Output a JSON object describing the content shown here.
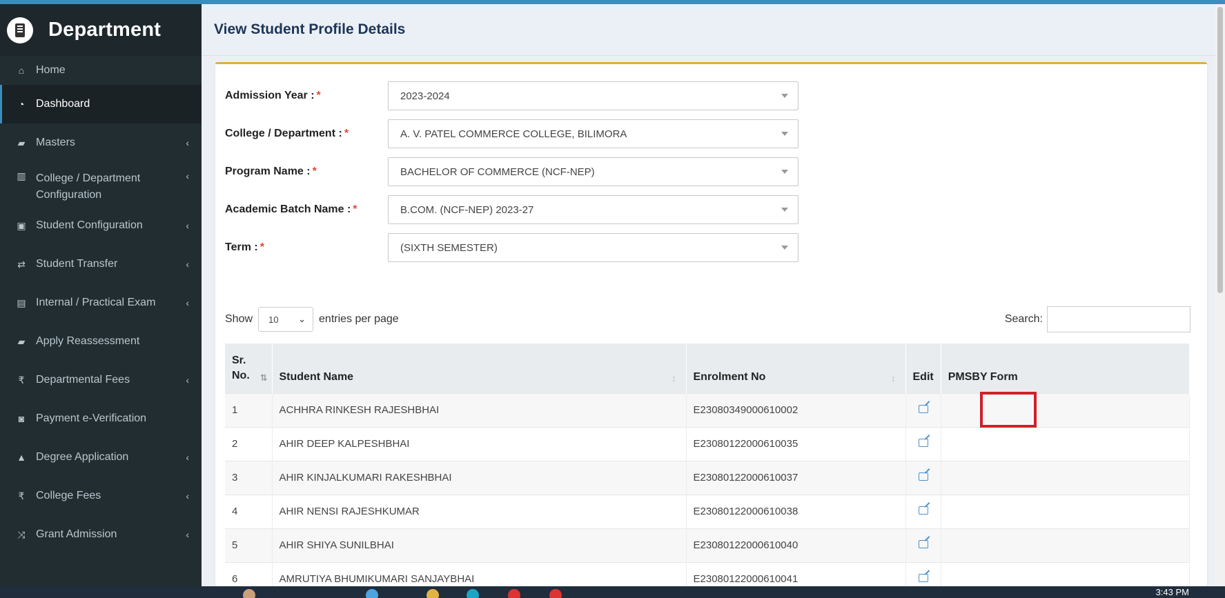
{
  "brand": {
    "title": "Department"
  },
  "sidebar": {
    "items": [
      {
        "label": "Home",
        "icon": "home-icon",
        "glyph": "⌂",
        "has_children": false
      },
      {
        "label": "Dashboard",
        "icon": "dashboard-icon",
        "glyph": "◔",
        "has_children": false,
        "active": true
      },
      {
        "label": "Masters",
        "icon": "book-icon",
        "glyph": "▰",
        "has_children": true
      },
      {
        "label": "College / Department Configuration",
        "icon": "institution-icon",
        "glyph": "▥",
        "has_children": true
      },
      {
        "label": "Student Configuration",
        "icon": "id-card-icon",
        "glyph": "▣",
        "has_children": true
      },
      {
        "label": "Student Transfer",
        "icon": "exchange-icon",
        "glyph": "⇄",
        "has_children": true
      },
      {
        "label": "Internal / Practical Exam",
        "icon": "list-icon",
        "glyph": "▤",
        "has_children": true
      },
      {
        "label": "Apply Reassessment",
        "icon": "book-icon",
        "glyph": "▰",
        "has_children": false
      },
      {
        "label": "Departmental Fees",
        "icon": "rupee-icon",
        "glyph": "₹",
        "has_children": true
      },
      {
        "label": "Payment e-Verification",
        "icon": "money-icon",
        "glyph": "◙",
        "has_children": false
      },
      {
        "label": "Degree Application",
        "icon": "graduation-cap-icon",
        "glyph": "▲",
        "has_children": true
      },
      {
        "label": "College Fees",
        "icon": "rupee-icon",
        "glyph": "₹",
        "has_children": true
      },
      {
        "label": "Grant Admission",
        "icon": "random-icon",
        "glyph": "⤨",
        "has_children": true
      }
    ]
  },
  "header": {
    "title": "View Student Profile Details"
  },
  "form": {
    "fields": [
      {
        "label": "Admission Year :",
        "value": "2023-2024"
      },
      {
        "label": "College / Department :",
        "value": "A. V. PATEL COMMERCE COLLEGE, BILIMORA"
      },
      {
        "label": "Program Name :",
        "value": "BACHELOR OF COMMERCE (NCF-NEP)"
      },
      {
        "label": "Academic Batch Name :",
        "value": "B.COM. (NCF-NEP) 2023-27"
      },
      {
        "label": "Term :",
        "value": "(SIXTH SEMESTER)"
      }
    ],
    "required_mark": "*"
  },
  "table_controls": {
    "show_label": "Show",
    "page_length": "10",
    "entries_label": "entries per page",
    "search_label": "Search:",
    "search_value": ""
  },
  "table": {
    "columns": [
      "Sr. No.",
      "Student Name",
      "Enrolment No",
      "Edit",
      "PMSBY Form"
    ],
    "rows": [
      {
        "sr": "1",
        "name": "ACHHRA RINKESH RAJESHBHAI",
        "enrolment": "E23080349000610002"
      },
      {
        "sr": "2",
        "name": "AHIR DEEP KALPESHBHAI",
        "enrolment": "E23080122000610035"
      },
      {
        "sr": "3",
        "name": "AHIR KINJALKUMARI RAKESHBHAI",
        "enrolment": "E23080122000610037"
      },
      {
        "sr": "4",
        "name": "AHIR NENSI RAJESHKUMAR",
        "enrolment": "E23080122000610038"
      },
      {
        "sr": "5",
        "name": "AHIR SHIYA SUNILBHAI",
        "enrolment": "E23080122000610040"
      },
      {
        "sr": "6",
        "name": "AMRUTIYA BHUMIKUMARI SANJAYBHAI",
        "enrolment": "E23080122000610041"
      }
    ]
  },
  "taskbar": {
    "time": "3:43 PM"
  },
  "colors": {
    "sidebar_bg": "#222d32",
    "accent": "#3c8dbc",
    "box_border": "#e0b12f",
    "highlight": "#d0202a"
  }
}
